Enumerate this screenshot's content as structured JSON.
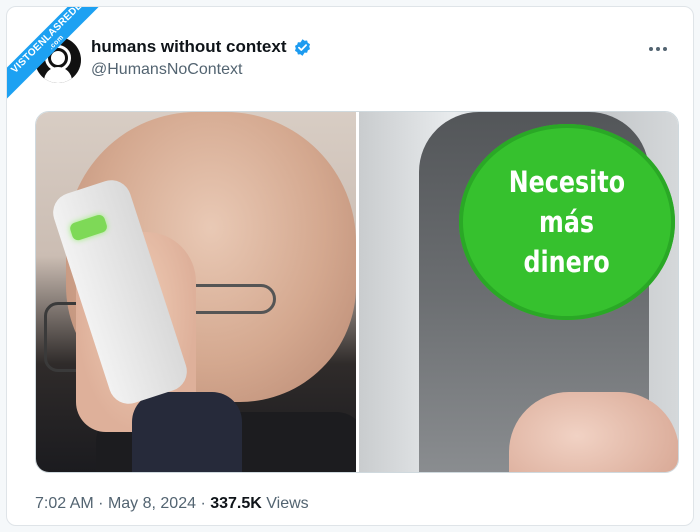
{
  "watermark": {
    "line1": "VISTOENLASREDES",
    "line2": ".com"
  },
  "author": {
    "name": "humans without context",
    "handle": "@HumansNoContext",
    "verified": true
  },
  "media": {
    "button_lines": [
      "Necesito",
      "más",
      "dinero"
    ]
  },
  "footer": {
    "time": "7:02 AM",
    "sep1": "·",
    "date": "May 8, 2024",
    "sep2": "·",
    "views_count": "337.5K",
    "views_label": "Views"
  },
  "colors": {
    "accent": "#1d9bf0",
    "button_green": "#36c12e"
  },
  "icons": {
    "verified": "verified-badge-icon",
    "more": "more-options-icon"
  }
}
